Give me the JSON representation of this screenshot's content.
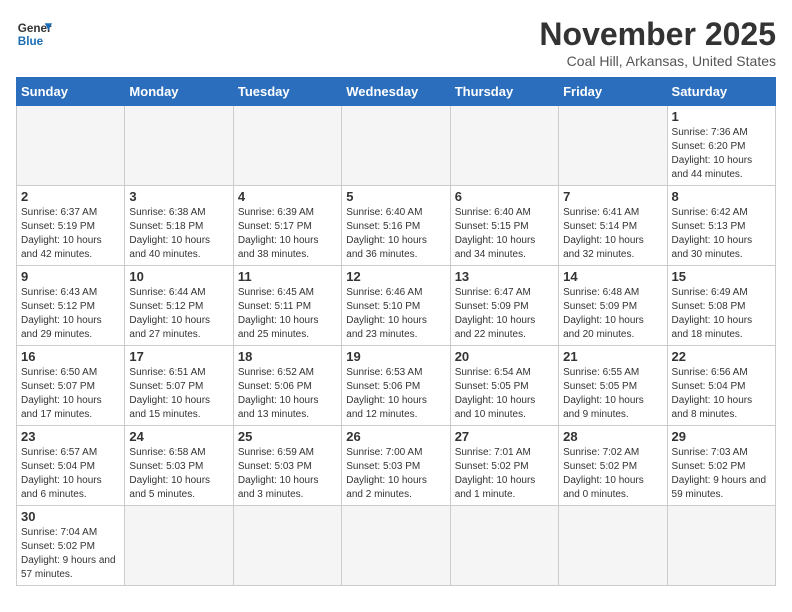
{
  "header": {
    "logo_general": "General",
    "logo_blue": "Blue",
    "title": "November 2025",
    "subtitle": "Coal Hill, Arkansas, United States"
  },
  "days_of_week": [
    "Sunday",
    "Monday",
    "Tuesday",
    "Wednesday",
    "Thursday",
    "Friday",
    "Saturday"
  ],
  "weeks": [
    [
      {
        "day": "",
        "info": ""
      },
      {
        "day": "",
        "info": ""
      },
      {
        "day": "",
        "info": ""
      },
      {
        "day": "",
        "info": ""
      },
      {
        "day": "",
        "info": ""
      },
      {
        "day": "",
        "info": ""
      },
      {
        "day": "1",
        "info": "Sunrise: 7:36 AM\nSunset: 6:20 PM\nDaylight: 10 hours and 44 minutes."
      }
    ],
    [
      {
        "day": "2",
        "info": "Sunrise: 6:37 AM\nSunset: 5:19 PM\nDaylight: 10 hours and 42 minutes."
      },
      {
        "day": "3",
        "info": "Sunrise: 6:38 AM\nSunset: 5:18 PM\nDaylight: 10 hours and 40 minutes."
      },
      {
        "day": "4",
        "info": "Sunrise: 6:39 AM\nSunset: 5:17 PM\nDaylight: 10 hours and 38 minutes."
      },
      {
        "day": "5",
        "info": "Sunrise: 6:40 AM\nSunset: 5:16 PM\nDaylight: 10 hours and 36 minutes."
      },
      {
        "day": "6",
        "info": "Sunrise: 6:40 AM\nSunset: 5:15 PM\nDaylight: 10 hours and 34 minutes."
      },
      {
        "day": "7",
        "info": "Sunrise: 6:41 AM\nSunset: 5:14 PM\nDaylight: 10 hours and 32 minutes."
      },
      {
        "day": "8",
        "info": "Sunrise: 6:42 AM\nSunset: 5:13 PM\nDaylight: 10 hours and 30 minutes."
      }
    ],
    [
      {
        "day": "9",
        "info": "Sunrise: 6:43 AM\nSunset: 5:12 PM\nDaylight: 10 hours and 29 minutes."
      },
      {
        "day": "10",
        "info": "Sunrise: 6:44 AM\nSunset: 5:12 PM\nDaylight: 10 hours and 27 minutes."
      },
      {
        "day": "11",
        "info": "Sunrise: 6:45 AM\nSunset: 5:11 PM\nDaylight: 10 hours and 25 minutes."
      },
      {
        "day": "12",
        "info": "Sunrise: 6:46 AM\nSunset: 5:10 PM\nDaylight: 10 hours and 23 minutes."
      },
      {
        "day": "13",
        "info": "Sunrise: 6:47 AM\nSunset: 5:09 PM\nDaylight: 10 hours and 22 minutes."
      },
      {
        "day": "14",
        "info": "Sunrise: 6:48 AM\nSunset: 5:09 PM\nDaylight: 10 hours and 20 minutes."
      },
      {
        "day": "15",
        "info": "Sunrise: 6:49 AM\nSunset: 5:08 PM\nDaylight: 10 hours and 18 minutes."
      }
    ],
    [
      {
        "day": "16",
        "info": "Sunrise: 6:50 AM\nSunset: 5:07 PM\nDaylight: 10 hours and 17 minutes."
      },
      {
        "day": "17",
        "info": "Sunrise: 6:51 AM\nSunset: 5:07 PM\nDaylight: 10 hours and 15 minutes."
      },
      {
        "day": "18",
        "info": "Sunrise: 6:52 AM\nSunset: 5:06 PM\nDaylight: 10 hours and 13 minutes."
      },
      {
        "day": "19",
        "info": "Sunrise: 6:53 AM\nSunset: 5:06 PM\nDaylight: 10 hours and 12 minutes."
      },
      {
        "day": "20",
        "info": "Sunrise: 6:54 AM\nSunset: 5:05 PM\nDaylight: 10 hours and 10 minutes."
      },
      {
        "day": "21",
        "info": "Sunrise: 6:55 AM\nSunset: 5:05 PM\nDaylight: 10 hours and 9 minutes."
      },
      {
        "day": "22",
        "info": "Sunrise: 6:56 AM\nSunset: 5:04 PM\nDaylight: 10 hours and 8 minutes."
      }
    ],
    [
      {
        "day": "23",
        "info": "Sunrise: 6:57 AM\nSunset: 5:04 PM\nDaylight: 10 hours and 6 minutes."
      },
      {
        "day": "24",
        "info": "Sunrise: 6:58 AM\nSunset: 5:03 PM\nDaylight: 10 hours and 5 minutes."
      },
      {
        "day": "25",
        "info": "Sunrise: 6:59 AM\nSunset: 5:03 PM\nDaylight: 10 hours and 3 minutes."
      },
      {
        "day": "26",
        "info": "Sunrise: 7:00 AM\nSunset: 5:03 PM\nDaylight: 10 hours and 2 minutes."
      },
      {
        "day": "27",
        "info": "Sunrise: 7:01 AM\nSunset: 5:02 PM\nDaylight: 10 hours and 1 minute."
      },
      {
        "day": "28",
        "info": "Sunrise: 7:02 AM\nSunset: 5:02 PM\nDaylight: 10 hours and 0 minutes."
      },
      {
        "day": "29",
        "info": "Sunrise: 7:03 AM\nSunset: 5:02 PM\nDaylight: 9 hours and 59 minutes."
      }
    ],
    [
      {
        "day": "30",
        "info": "Sunrise: 7:04 AM\nSunset: 5:02 PM\nDaylight: 9 hours and 57 minutes."
      },
      {
        "day": "",
        "info": ""
      },
      {
        "day": "",
        "info": ""
      },
      {
        "day": "",
        "info": ""
      },
      {
        "day": "",
        "info": ""
      },
      {
        "day": "",
        "info": ""
      },
      {
        "day": "",
        "info": ""
      }
    ]
  ]
}
